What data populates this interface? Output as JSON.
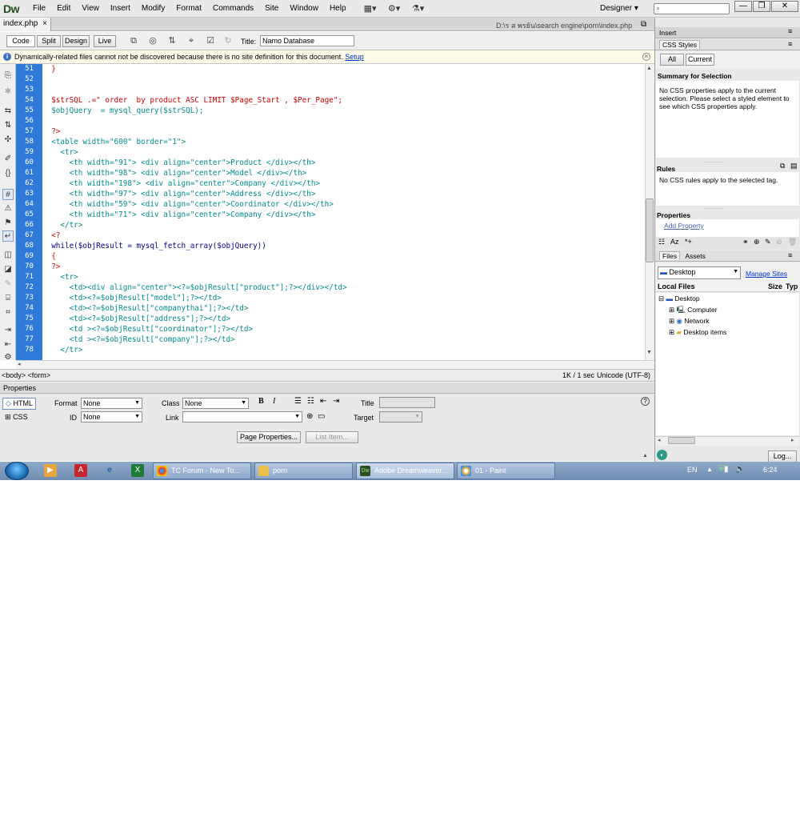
{
  "app": {
    "logo": "Dw",
    "menu": [
      "File",
      "Edit",
      "View",
      "Insert",
      "Modify",
      "Format",
      "Commands",
      "Site",
      "Window",
      "Help"
    ],
    "workspace": "Designer",
    "workspace_caret": "▾",
    "search_placeholder": ""
  },
  "document": {
    "tab_label": "index.php",
    "tab_close": "×",
    "path": "D:\\ร ส พรยัน\\search engine\\porn\\index.php",
    "view_buttons": [
      "Code",
      "Split",
      "Design",
      "Live"
    ],
    "title_label": "Title:",
    "title_value": "Namo Database"
  },
  "infobar": {
    "message": "Dynamically-related files cannot not be discovered because there is no site definition for this document.",
    "link": "Setup"
  },
  "code": {
    "line_numbers": [
      "51",
      "52",
      "53",
      "54",
      "55",
      "56",
      "57",
      "58",
      "59",
      "60",
      "61",
      "62",
      "63",
      "64",
      "65",
      "66",
      "67",
      "68",
      "69",
      "70",
      "71",
      "72",
      "73",
      "74",
      "75",
      "76",
      "77",
      "78"
    ],
    "lines": [
      "  }",
      "",
      "",
      "  $strSQL .=\" order  by product ASC LIMIT $Page_Start , $Per_Page\";",
      "  $objQuery  = mysql_query($strSQL);",
      "",
      "  ?>",
      "  <table width=\"600\" border=\"1\">",
      "    <tr>",
      "      <th width=\"91\"> <div align=\"center\">Product </div></th>",
      "      <th width=\"98\"> <div align=\"center\">Model </div></th>",
      "      <th width=\"198\"> <div align=\"center\">Company </div></th>",
      "      <th width=\"97\"> <div align=\"center\">Address </div></th>",
      "      <th width=\"59\"> <div align=\"center\">Coordinator </div></th>",
      "      <th width=\"71\"> <div align=\"center\">Company </div></th>",
      "    </tr>",
      "  <?",
      "  while($objResult = mysql_fetch_array($objQuery))",
      "  {",
      "  ?>",
      "    <tr>",
      "      <td><div align=\"center\"><?=$objResult[\"product\"];?></div></td>",
      "      <td><?=$objResult[\"model\"];?></td>",
      "      <td><?=$objResult[\"companythai\"];?></td>",
      "      <td><?=$objResult[\"address\"];?></td>",
      "      <td ><?=$objResult[\"coordinator\"];?></td>",
      "      <td ><?=$objResult[\"company\"];?></td>",
      "    </tr>"
    ]
  },
  "statusbar": {
    "tag_selector": "<body> <form>",
    "size_time": "1K / 1 sec",
    "encoding": "Unicode (UTF-8)"
  },
  "properties": {
    "header": "Properties",
    "html_button": "HTML",
    "css_button": "CSS",
    "format_label": "Format",
    "format_value": "None",
    "id_label": "ID",
    "id_value": "None",
    "class_label": "Class",
    "class_value": "None",
    "link_label": "Link",
    "link_value": "",
    "title_label": "Title",
    "title_value": "",
    "target_label": "Target",
    "target_value": "",
    "page_properties_button": "Page Properties...",
    "list_item_button": "List Item..."
  },
  "panels": {
    "insert_tab": "Insert",
    "css_styles_tab": "CSS Styles",
    "all_button": "All",
    "current_button": "Current",
    "summary_heading": "Summary for Selection",
    "summary_text": "No CSS properties apply to the current selection.  Please select a styled element to see which CSS properties apply.",
    "rules_heading": "Rules",
    "rules_text": "No CSS rules apply to the selected tag.",
    "properties_heading": "Properties",
    "add_property": "Add Property",
    "files_tab": "Files",
    "assets_tab": "Assets",
    "site_select": "Desktop",
    "manage_sites": "Manage Sites",
    "local_files_header": "Local Files",
    "size_header": "Size",
    "type_header": "Typ",
    "tree": [
      {
        "label": "Desktop",
        "level": 0,
        "expander": "⊟"
      },
      {
        "label": "Computer",
        "level": 1,
        "expander": "⊞"
      },
      {
        "label": "Network",
        "level": 1,
        "expander": "⊞"
      },
      {
        "label": "Desktop items",
        "level": 1,
        "expander": "⊞"
      }
    ],
    "log_button": "Log..."
  },
  "taskbar": {
    "tasks": [
      "TC Forum - New To...",
      "porn",
      "Adobe Dreamweaver...",
      "01 - Paint"
    ],
    "language": "EN",
    "clock": "6:24"
  },
  "colors": {
    "gutter_blue": "#2f7ad9",
    "php_red": "#cc0000",
    "tag_navy": "#000088",
    "teal": "#008b8b",
    "taskbar": "#7e98bd"
  }
}
